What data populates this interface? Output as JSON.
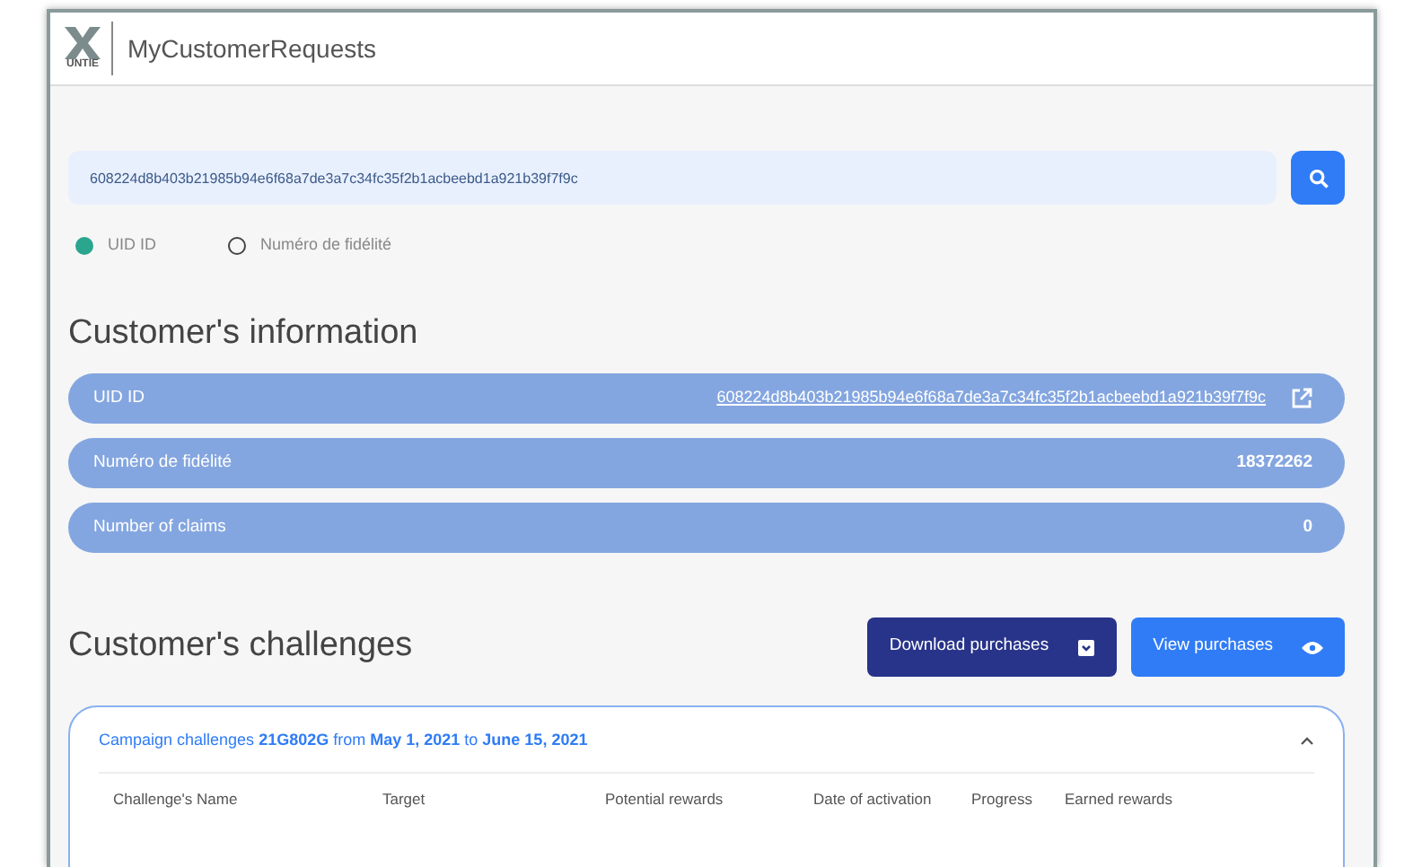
{
  "app": {
    "logo_text": "UNTIE",
    "title": "MyCustomerRequests"
  },
  "search": {
    "value": "608224d8b403b21985b94e6f68a7de3a7c34fc35f2b1acbeebd1a921b39f7f9c"
  },
  "search_by": [
    {
      "label": "UID ID",
      "selected": true
    },
    {
      "label": "Numéro de fidélité",
      "selected": false
    }
  ],
  "customer_information": {
    "title": "Customer's information",
    "rows": [
      {
        "label": "UID ID",
        "value": "608224d8b403b21985b94e6f68a7de3a7c34fc35f2b1acbeebd1a921b39f7f9c",
        "kind": "link"
      },
      {
        "label": "Numéro de fidélité",
        "value": "18372262",
        "kind": "text"
      },
      {
        "label": "Number of claims",
        "value": "0",
        "kind": "text"
      }
    ]
  },
  "customer_challenges": {
    "title": "Customer's challenges",
    "buttons": [
      {
        "label": "Download purchases",
        "kind": "download"
      },
      {
        "label": "View purchases",
        "kind": "view"
      }
    ],
    "campaign": {
      "heading": "Campaign challenges **21G802G** from **May 1, 2021** to **June 15, 2021**",
      "expanded": true,
      "columns": [
        "Challenge's Name",
        "Target",
        "Potential rewards",
        "Date of activation",
        "Progress",
        "Earned rewards"
      ]
    }
  }
}
